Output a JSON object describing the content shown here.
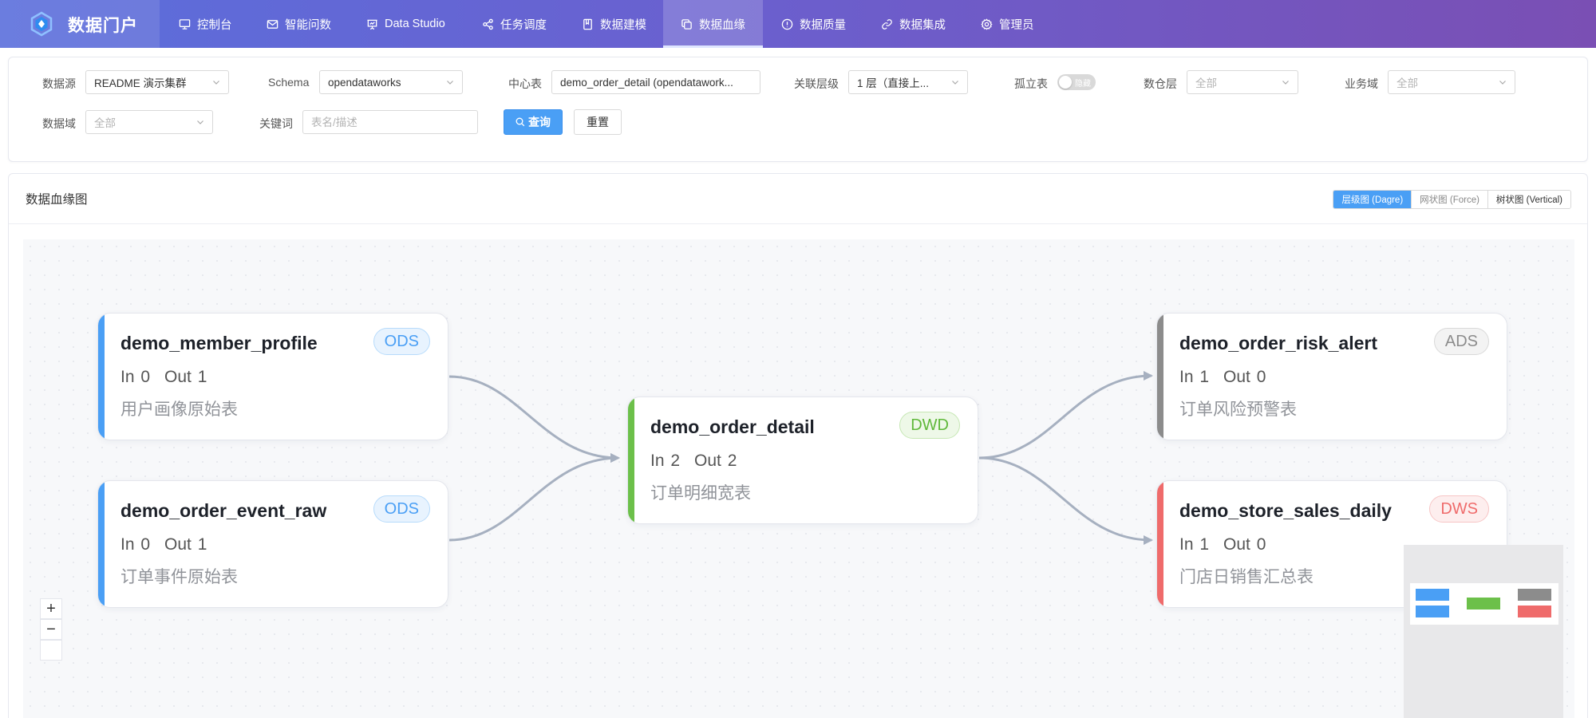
{
  "brand": {
    "title": "数据门户"
  },
  "nav": [
    {
      "id": "dashboard",
      "label": "控制台",
      "icon": "monitor-icon"
    },
    {
      "id": "ask",
      "label": "智能问数",
      "icon": "mail-icon"
    },
    {
      "id": "studio",
      "label": "Data Studio",
      "icon": "presentation-icon"
    },
    {
      "id": "schedule",
      "label": "任务调度",
      "icon": "share-icon"
    },
    {
      "id": "modeling",
      "label": "数据建模",
      "icon": "book-icon"
    },
    {
      "id": "lineage",
      "label": "数据血缘",
      "icon": "copy-icon",
      "active": true
    },
    {
      "id": "quality",
      "label": "数据质量",
      "icon": "info-icon"
    },
    {
      "id": "integration",
      "label": "数据集成",
      "icon": "link-icon"
    },
    {
      "id": "admin",
      "label": "管理员",
      "icon": "gear-icon"
    }
  ],
  "filters": {
    "datasource": {
      "label": "数据源",
      "value": "README 演示集群"
    },
    "schema": {
      "label": "Schema",
      "value": "opendataworks"
    },
    "center_table": {
      "label": "中心表",
      "value": "demo_order_detail (opendatawork..."
    },
    "depth": {
      "label": "关联层级",
      "value": "1 层（直接上..."
    },
    "isolated": {
      "label": "孤立表",
      "toggle_text": "隐藏"
    },
    "warehouse_layer": {
      "label": "数仓层",
      "placeholder": "全部"
    },
    "business_domain": {
      "label": "业务域",
      "placeholder": "全部"
    },
    "data_domain": {
      "label": "数据域",
      "placeholder": "全部"
    },
    "keyword": {
      "label": "关键词",
      "placeholder": "表名/描述"
    },
    "query_button": "查询",
    "reset_button": "重置"
  },
  "lineage": {
    "title": "数据血缘图",
    "views": [
      {
        "label": "层级图 (Dagre)",
        "active": true
      },
      {
        "label": "网状图 (Force)",
        "active": false
      },
      {
        "label": "树状图 (Vertical)",
        "active": false
      }
    ],
    "nodes": [
      {
        "id": "n1",
        "name": "demo_member_profile",
        "layer": "ODS",
        "in": "In 0",
        "out": "Out 1",
        "desc": "用户画像原始表",
        "color": "#4a9ff5"
      },
      {
        "id": "n2",
        "name": "demo_order_event_raw",
        "layer": "ODS",
        "in": "In 0",
        "out": "Out 1",
        "desc": "订单事件原始表",
        "color": "#4a9ff5"
      },
      {
        "id": "n3",
        "name": "demo_order_detail",
        "layer": "DWD",
        "in": "In 2",
        "out": "Out 2",
        "desc": "订单明细宽表",
        "color": "#6cc04a"
      },
      {
        "id": "n4",
        "name": "demo_order_risk_alert",
        "layer": "ADS",
        "in": "In 1",
        "out": "Out 0",
        "desc": "订单风险预警表",
        "color": "#8c8c8c"
      },
      {
        "id": "n5",
        "name": "demo_store_sales_daily",
        "layer": "DWS",
        "in": "In 1",
        "out": "Out 0",
        "desc": "门店日销售汇总表",
        "color": "#ef6b6b"
      }
    ],
    "zoom_in": "+",
    "zoom_out": "−"
  },
  "colors": {
    "nav_start": "#5b6fdc",
    "nav_end": "#7a4fb4",
    "primary": "#4a9ff5",
    "edge": "#a6b0c0"
  }
}
